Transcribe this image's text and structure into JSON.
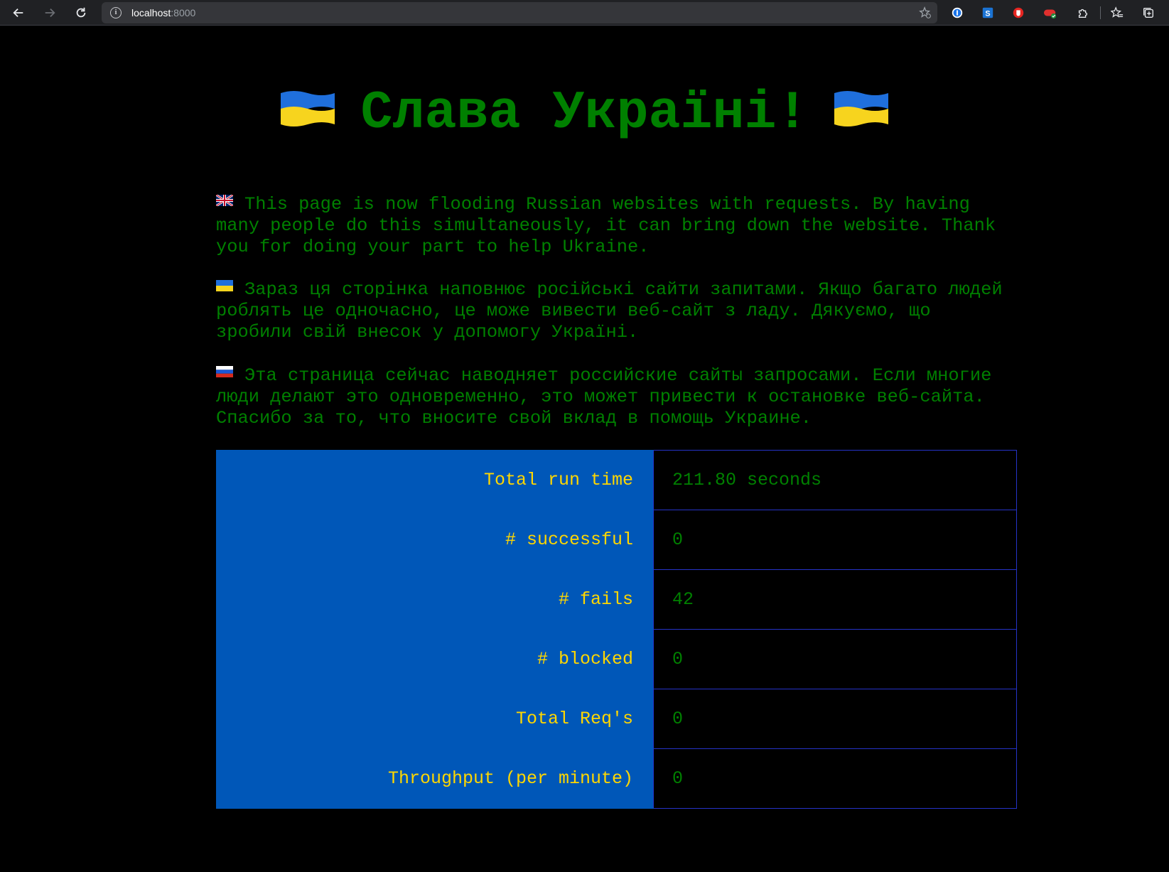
{
  "browser": {
    "url_host": "localhost",
    "url_port": ":8000"
  },
  "page": {
    "title": "Слава Україні!",
    "paragraphs": {
      "en": "This page is now flooding Russian websites with requests. By having many people do this simultaneously, it can bring down the website. Thank you for doing your part to help Ukraine.",
      "uk": "Зараз ця сторінка наповнює російські сайти запитами. Якщо багато людей роблять це одночасно, це може вивести веб-сайт з ладу. Дякуємо, що зробили свій внесок у допомогу Україні.",
      "ru": "Эта страница сейчас наводняет российские сайты запросами. Если многие люди делают это одновременно, это может привести к остановке веб-сайта. Спасибо за то, что вносите свой вклад в помощь Украине."
    },
    "stats": [
      {
        "label": "Total run time",
        "value": "211.80 seconds"
      },
      {
        "label": "# successful",
        "value": "0"
      },
      {
        "label": "# fails",
        "value": "42"
      },
      {
        "label": "# blocked",
        "value": "0"
      },
      {
        "label": "Total Req's",
        "value": "0"
      },
      {
        "label": "Throughput (per minute)",
        "value": "0"
      }
    ]
  },
  "colors": {
    "text_green": "#008000",
    "label_yellow": "#ffd700",
    "label_bg_blue": "#0057b8",
    "border_blue": "#2533c7"
  },
  "icons": {
    "title_flags": "ukraine-flag",
    "paragraph_flags": [
      "uk-flag",
      "ukraine-flag",
      "russia-flag"
    ]
  }
}
